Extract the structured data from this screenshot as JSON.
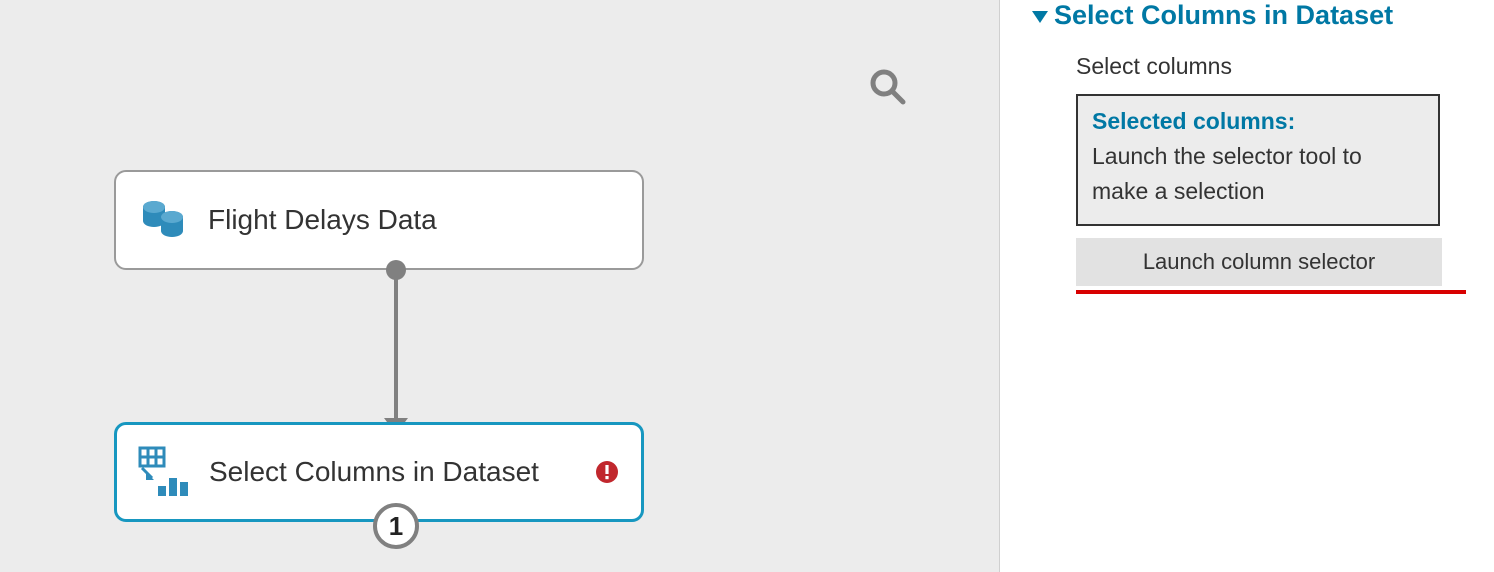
{
  "canvas": {
    "nodes": {
      "dataset": {
        "label": "Flight Delays Data"
      },
      "select_cols": {
        "label": "Select Columns in Dataset"
      }
    },
    "port_number": "1"
  },
  "panel": {
    "heading": "Select Columns in Dataset",
    "sublabel": "Select columns",
    "selected_title": "Selected columns:",
    "selected_hint": "Launch the selector tool to make a selection",
    "launch_label": "Launch column selector"
  }
}
